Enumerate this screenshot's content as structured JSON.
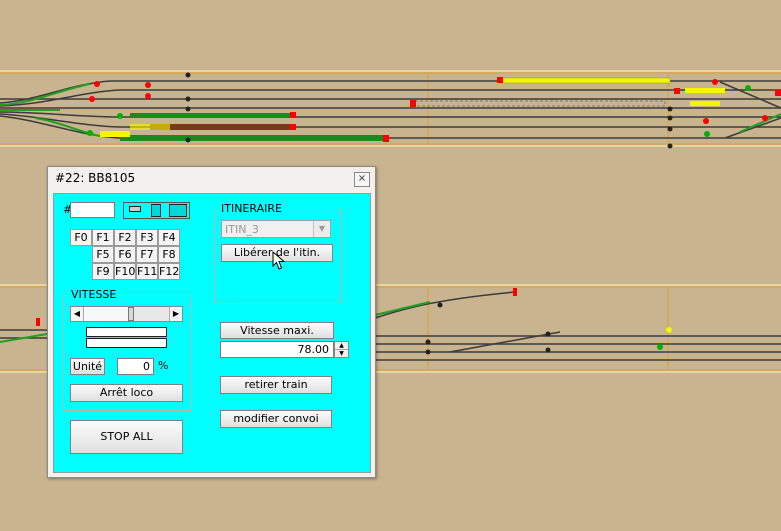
{
  "dialog": {
    "title": "#22: BB8105",
    "close_glyph": "×",
    "address_label": "#",
    "address_value": "",
    "view_icons": [
      "view-small-icon",
      "view-medium-icon",
      "view-large-icon"
    ],
    "function_keys": [
      "F0",
      "F1",
      "F2",
      "F3",
      "F4",
      "F5",
      "F6",
      "F7",
      "F8",
      "F9",
      "F10",
      "F11",
      "F12"
    ],
    "vitesse": {
      "label": "VITESSE",
      "unit_button": "Unité",
      "speed_value": "0",
      "speed_unit": "%",
      "slider_level_percent": 52,
      "stop_loco_button": "Arrêt loco"
    },
    "stop_all_button": "STOP ALL",
    "itineraire": {
      "label": "ITINERAIRE",
      "selected": "ITIN_3",
      "free_button": "Libérer de l'itin."
    },
    "vitesse_maxi": {
      "label": "Vitesse maxi.",
      "value": "78.00"
    },
    "remove_train_button": "retirer train",
    "modify_convoy_button": "modifier convoi"
  },
  "colors": {
    "background": "#c8b48e",
    "dialog_panel": "#00ffff",
    "track": "#3c3c3c",
    "signal_red": "#ff0000",
    "signal_green": "#00b000",
    "occupied_yellow": "#f5f500",
    "occupied_green": "#1a8a1a",
    "occupied_brown": "#7a3a1a"
  }
}
